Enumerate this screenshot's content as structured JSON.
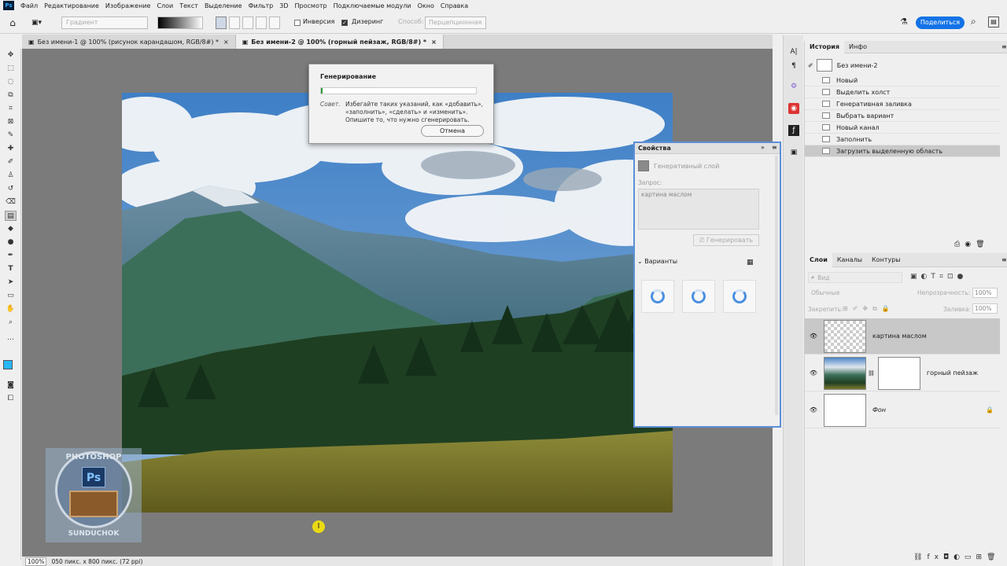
{
  "menu": [
    "Файл",
    "Редактирование",
    "Изображение",
    "Слои",
    "Текст",
    "Выделение",
    "Фильтр",
    "3D",
    "Просмотр",
    "Подключаемые модули",
    "Окно",
    "Справка"
  ],
  "options": {
    "gradient_label": "Градиент",
    "inversion": "Инверсия",
    "dithering": "Дизеринг",
    "method_label": "Способ:",
    "method_value": "Перцепционная",
    "share": "Поделиться"
  },
  "tabs": [
    "Без имени-1 @ 100% (рисунок карандашом, RGB/8#) *",
    "Без имени-2 @ 100% (горный пейзаж, RGB/8#) *"
  ],
  "status": {
    "zoom": "100%",
    "info": "050 пикс. x 800 пикс. (72 ppi)"
  },
  "dialog": {
    "title": "Генерирование",
    "progress": 0.01,
    "tip_label": "Совет.",
    "tip_text": "Избегайте таких указаний, как «добавить», «заполнить», «сделать» и «изменить». Опишите то, что нужно сгенерировать.",
    "cancel": "Отмена"
  },
  "properties": {
    "title": "Свойства",
    "layer_type": "Генеративный слой",
    "prompt_label": "Запрос:",
    "prompt_value": "картина маслом",
    "generate": "Генерировать",
    "variants": "Варианты"
  },
  "history": {
    "tabs": [
      "История",
      "Инфо"
    ],
    "snapshot": "Без имени-2",
    "items": [
      "Новый",
      "Выделить холст",
      "Генеративная заливка",
      "Выбрать вариант",
      "Новый канал",
      "Заполнить",
      "Загрузить выделенную область"
    ],
    "selected_index": 6
  },
  "layers": {
    "tabs": [
      "Слои",
      "Каналы",
      "Контуры"
    ],
    "search_placeholder": "Вид",
    "blend": "Обычные",
    "opacity_label": "Непрозрачность:",
    "opacity": "100%",
    "lock_label": "Закрепить:",
    "fill_label": "Заливка:",
    "fill": "100%",
    "items": [
      "картина маслом",
      "горный пейзаж",
      "Фон"
    ]
  },
  "watermark": {
    "top": "PHOTOSHOP",
    "bottom": "SUNDUCHOK",
    "logo": "Ps"
  }
}
